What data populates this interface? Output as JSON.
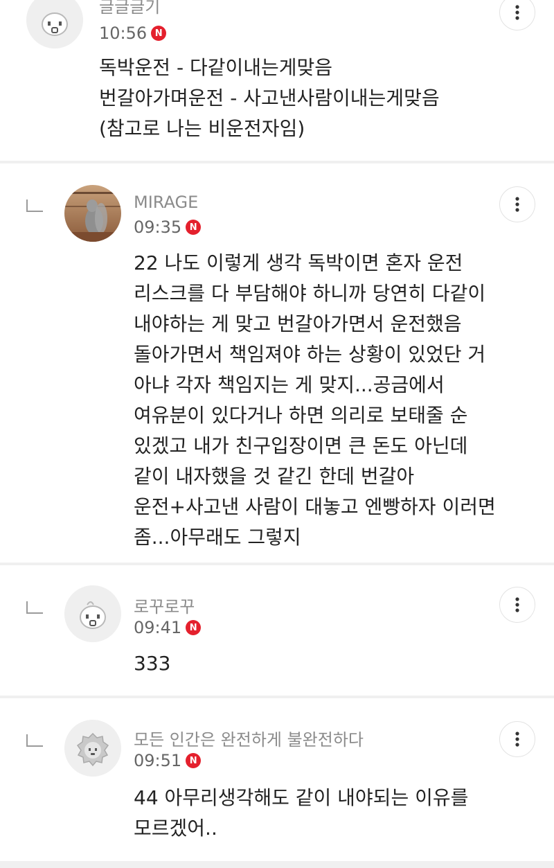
{
  "comments": [
    {
      "name": "글글글기",
      "time": "10:56",
      "badge": "N",
      "avatar": "kakao-face-avatar",
      "lines": [
        "독박운전 - 다같이내는게맞음",
        "번갈아가며운전 - 사고낸사람이내는게맞음",
        "(참고로 나는 비운전자임)"
      ]
    },
    {
      "name": "MIRAGE",
      "time": "09:35",
      "badge": "N",
      "avatar": "squirrel-photo-avatar",
      "lines": [
        "22 나도 이렇게 생각 독박이면 혼자 운전",
        "리스크를 다 부담해야 하니까 당연히 다같이",
        "내야하는 게 맞고 번갈아가면서 운전했음",
        "돌아가면서 책임져야 하는 상황이 있었단 거",
        "아냐 각자 책임지는 게 맞지...공금에서",
        "여유분이 있다거나 하면 의리로 보태줄 순",
        "있겠고 내가 친구입장이면 큰 돈도 아닌데",
        "같이 내자했을 것 같긴 한데 번갈아",
        "운전+사고낸 사람이 대놓고 엔빵하자 이러면",
        "좀...아무래도 그렇지"
      ]
    },
    {
      "name": "로꾸로꾸",
      "time": "09:41",
      "badge": "N",
      "avatar": "kakao-face-avatar",
      "lines": [
        "333"
      ]
    },
    {
      "name": "모든 인간은 완전하게 불완전하다",
      "time": "09:51",
      "badge": "N",
      "avatar": "lion-face-avatar",
      "lines": [
        "44 아무리생각해도 같이 내야되는 이유를",
        "모르겠어.."
      ]
    }
  ]
}
